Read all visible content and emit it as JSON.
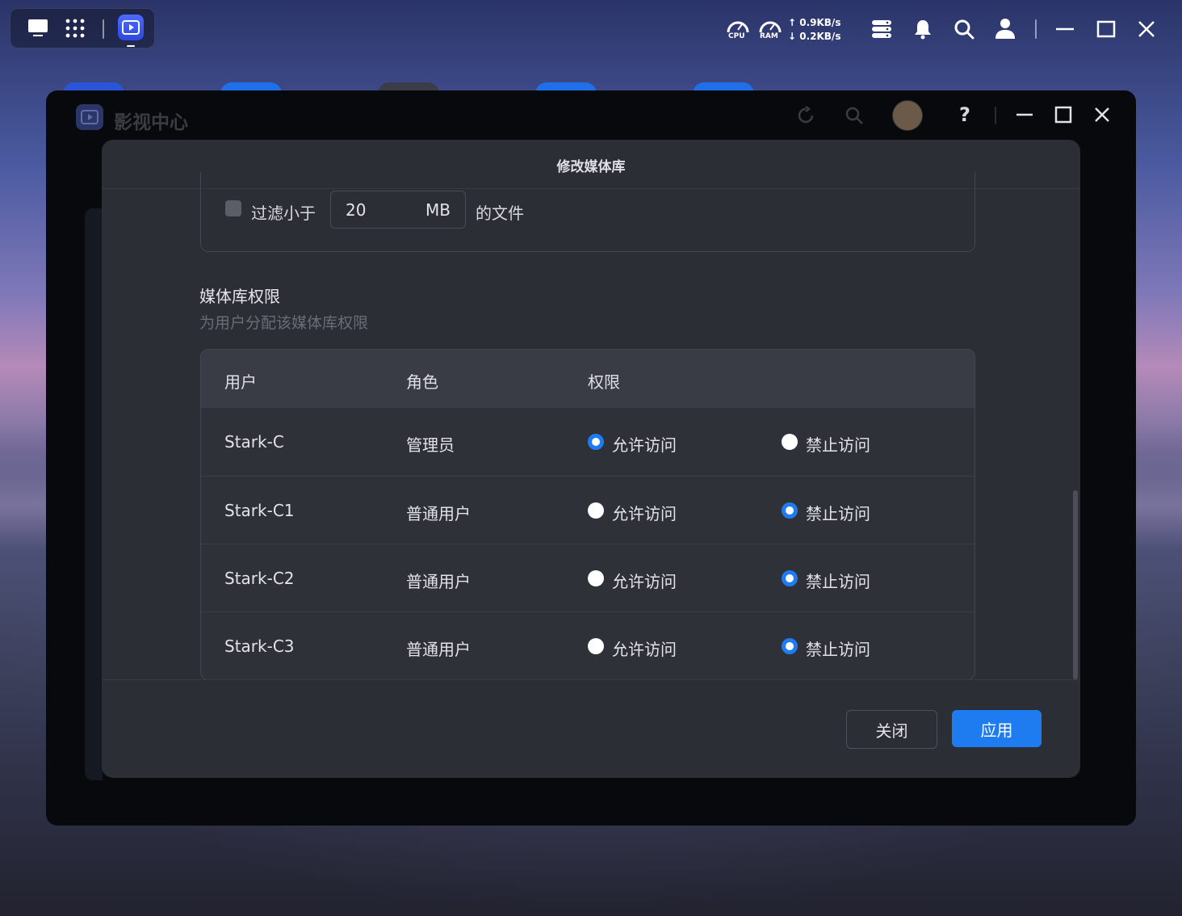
{
  "taskbar": {
    "cpu_label": "CPU",
    "ram_label": "RAM",
    "upload_speed": "↑ 0.9KB/s",
    "download_speed": "↓ 0.2KB/s",
    "icons": [
      "desktop-icon",
      "app-grid-icon",
      "video-center-icon",
      "server-icon",
      "bell-icon",
      "search-icon",
      "user-icon",
      "minimize-icon",
      "maximize-icon",
      "close-icon"
    ]
  },
  "app": {
    "title": "影视中心"
  },
  "dialog": {
    "title": "修改媒体库",
    "filter": {
      "label": "过滤小于",
      "value": "20",
      "unit": "MB",
      "suffix": "的文件",
      "checked": false
    },
    "permissions": {
      "title": "媒体库权限",
      "subtitle": "为用户分配该媒体库权限",
      "headers": {
        "user": "用户",
        "role": "角色",
        "permission": "权限"
      },
      "allow_label": "允许访问",
      "deny_label": "禁止访问",
      "rows": [
        {
          "user": "Stark-C",
          "role": "管理员",
          "allow_label": "允许访问",
          "deny_label": "禁止访问",
          "selected": "allow"
        },
        {
          "user": "Stark-C1",
          "role": "普通用户",
          "allow_label": "允许访问",
          "deny_label": "禁止访问",
          "selected": "deny"
        },
        {
          "user": "Stark-C2",
          "role": "普通用户",
          "allow_label": "允许访问",
          "deny_label": "禁止访问",
          "selected": "deny"
        },
        {
          "user": "Stark-C3",
          "role": "普通用户",
          "allow_label": "允许访问",
          "deny_label": "禁止访问",
          "selected": "deny"
        }
      ]
    },
    "buttons": {
      "close": "关闭",
      "apply": "应用"
    }
  },
  "colors": {
    "accent": "#1e7cf0",
    "dialog_bg": "#2b2e35",
    "window_bg": "#07090d"
  }
}
